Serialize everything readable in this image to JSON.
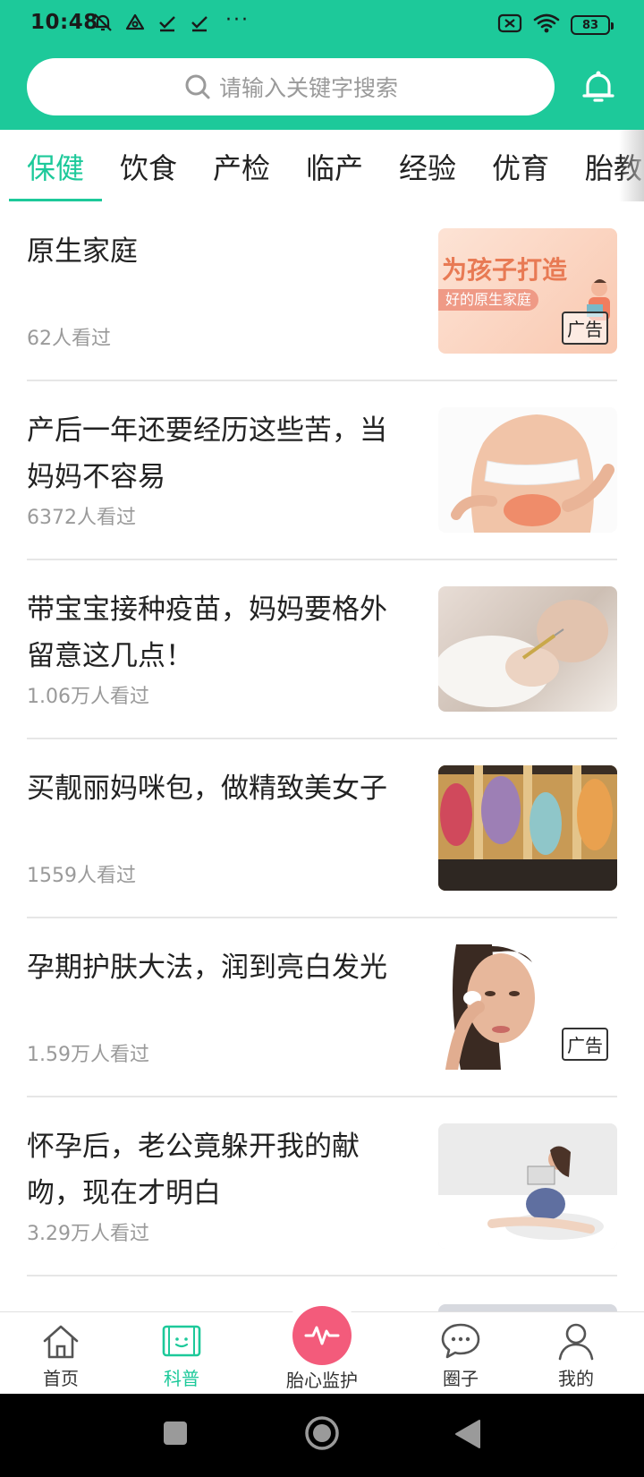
{
  "status_bar": {
    "time": "10:48",
    "battery": "83",
    "more": "···"
  },
  "search": {
    "placeholder": "请输入关键字搜索"
  },
  "colors": {
    "accent": "#1dc99a",
    "heart": "#f35b7b"
  },
  "tabs": [
    {
      "label": "保健",
      "active": true
    },
    {
      "label": "饮食",
      "active": false
    },
    {
      "label": "产检",
      "active": false
    },
    {
      "label": "临产",
      "active": false
    },
    {
      "label": "经验",
      "active": false
    },
    {
      "label": "优育",
      "active": false
    },
    {
      "label": "胎教",
      "active": false
    }
  ],
  "articles": [
    {
      "title": "原生家庭",
      "views": "62人看过",
      "ad": "广告",
      "thumb_text_1": "为孩子打造",
      "thumb_text_2": "好的原生家庭"
    },
    {
      "title": "产后一年还要经历这些苦，当妈妈不容易",
      "views": "6372人看过"
    },
    {
      "title": "带宝宝接种疫苗，妈妈要格外留意这几点！",
      "views": "1.06万人看过"
    },
    {
      "title": "买靓丽妈咪包，做精致美女子",
      "views": "1559人看过"
    },
    {
      "title": "孕期护肤大法，润到亮白发光",
      "views": "1.59万人看过",
      "ad": "广告"
    },
    {
      "title": "怀孕后，老公竟躲开我的献吻，现在才明白",
      "views": "3.29万人看过"
    }
  ],
  "bottom_nav": {
    "home": "首页",
    "science": "科普",
    "fetal_monitor": "胎心监护",
    "circle": "圈子",
    "mine": "我的"
  }
}
